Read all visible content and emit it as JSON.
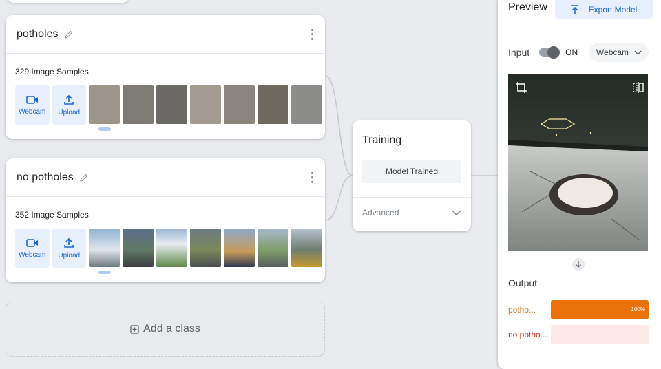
{
  "classes": [
    {
      "name": "potholes",
      "sample_count": "329 Image Samples",
      "webcam_label": "Webcam",
      "upload_label": "Upload",
      "thumb_colors": [
        "#9e958a",
        "#7e7a74",
        "#6c6a66",
        "#a39b8f",
        "#8b867d",
        "#6f6a60",
        "#8d8d8c"
      ]
    },
    {
      "name": "no potholes",
      "sample_count": "352 Image Samples",
      "webcam_label": "Webcam",
      "upload_label": "Upload",
      "thumb_colors": [
        "#6f93b6",
        "#5f7a64",
        "#8ea4c2",
        "#6b7b84",
        "#c89a5a",
        "#7ea068",
        "#6f7e70"
      ]
    }
  ],
  "add_class_label": "Add a class",
  "training": {
    "title": "Training",
    "button_label": "Model Trained",
    "advanced_label": "Advanced"
  },
  "preview": {
    "title": "Preview",
    "export_label": "Export Model",
    "input_label": "Input",
    "toggle_state": "ON",
    "source_select": "Webcam",
    "output_title": "Output",
    "outputs": [
      {
        "label": "potho...",
        "value_pct": 100,
        "value_text": "100%",
        "color": "#e8710a",
        "track_color": "#e8710a",
        "label_color": "#e8710a"
      },
      {
        "label": "no potho...",
        "value_pct": 0,
        "value_text": "",
        "color": "#fce8e6",
        "track_color": "#fce8e6",
        "label_color": "#d93025"
      }
    ]
  },
  "colors": {
    "accent_blue": "#1967d2",
    "accent_blue_light": "#e8f0fe",
    "background": "#e8eaed"
  },
  "icons": [
    "pencil-icon",
    "more-vert-icon",
    "videocam-icon",
    "upload-icon",
    "add-box-icon",
    "chevron-down-icon",
    "export-icon",
    "crop-icon",
    "flip-camera-icon",
    "arrow-down-icon"
  ]
}
